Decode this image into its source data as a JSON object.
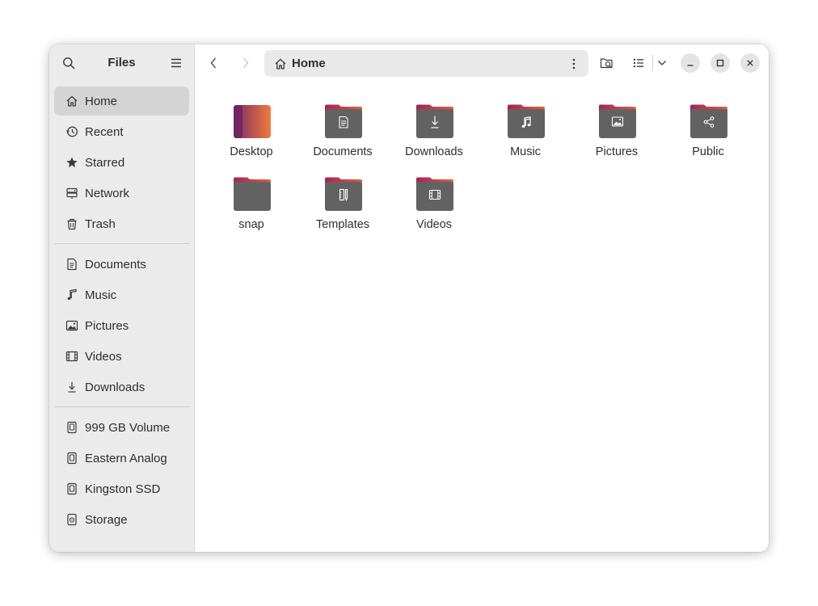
{
  "app": {
    "title": "Files"
  },
  "sidebar": {
    "places": [
      {
        "label": "Home",
        "icon": "home-icon",
        "active": true
      },
      {
        "label": "Recent",
        "icon": "recent-icon"
      },
      {
        "label": "Starred",
        "icon": "star-icon"
      },
      {
        "label": "Network",
        "icon": "network-icon"
      },
      {
        "label": "Trash",
        "icon": "trash-icon"
      }
    ],
    "bookmarks": [
      {
        "label": "Documents",
        "icon": "document-icon"
      },
      {
        "label": "Music",
        "icon": "music-icon"
      },
      {
        "label": "Pictures",
        "icon": "picture-icon"
      },
      {
        "label": "Videos",
        "icon": "video-icon"
      },
      {
        "label": "Downloads",
        "icon": "download-icon"
      }
    ],
    "devices": [
      {
        "label": "999 GB Volume",
        "icon": "drive-icon"
      },
      {
        "label": "Eastern Analog",
        "icon": "drive-icon"
      },
      {
        "label": "Kingston SSD",
        "icon": "drive-icon"
      },
      {
        "label": "Storage",
        "icon": "disk-icon"
      }
    ]
  },
  "pathbar": {
    "label": "Home"
  },
  "folders": [
    {
      "name": "Desktop",
      "emblem": "desktop"
    },
    {
      "name": "Documents",
      "emblem": "document"
    },
    {
      "name": "Downloads",
      "emblem": "download"
    },
    {
      "name": "Music",
      "emblem": "music"
    },
    {
      "name": "Pictures",
      "emblem": "picture"
    },
    {
      "name": "Public",
      "emblem": "share"
    },
    {
      "name": "snap",
      "emblem": "none"
    },
    {
      "name": "Templates",
      "emblem": "template"
    },
    {
      "name": "Videos",
      "emblem": "video"
    }
  ],
  "colors": {
    "folder_body": "#626262",
    "folder_tab_left": "#a3245a",
    "folder_tab_right": "#e2603a",
    "desktop_left": "#7a2a6b",
    "desktop_right": "#f07a3c",
    "sidebar_bg": "#ebebeb",
    "sidebar_active": "#d4d4d4"
  }
}
